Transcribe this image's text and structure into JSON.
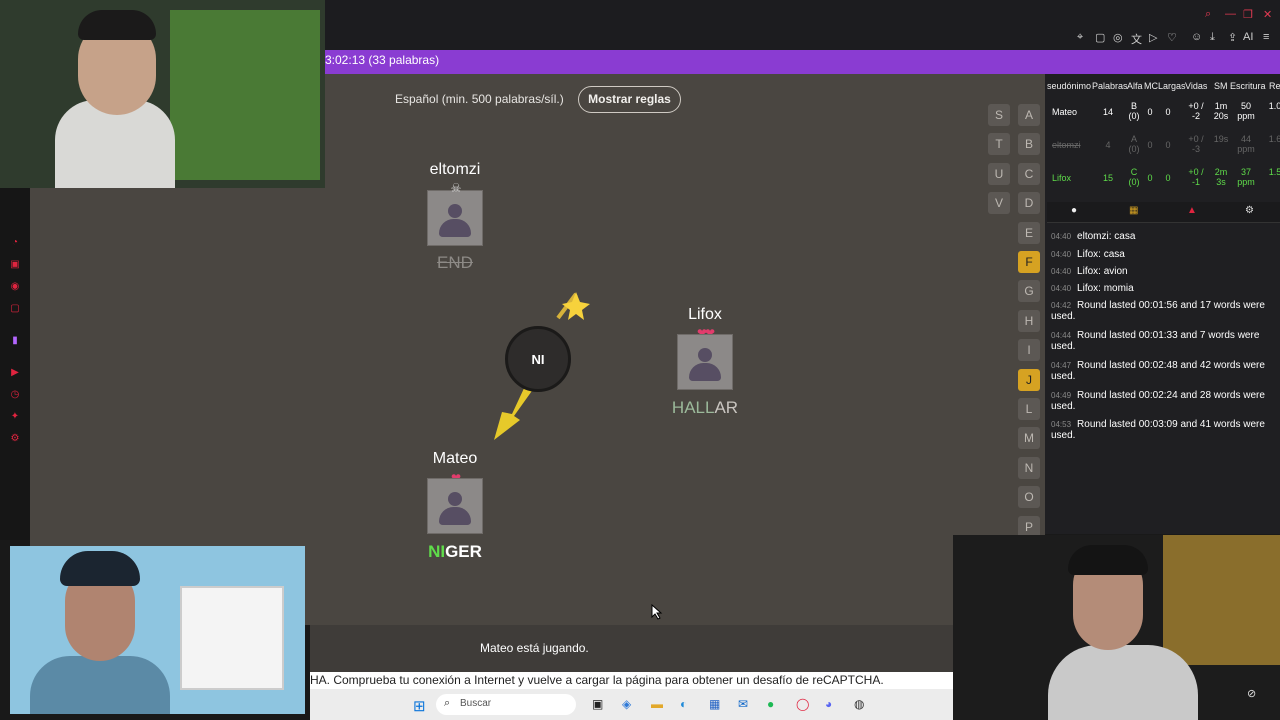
{
  "game": {
    "timer": "3:02:13 (33 palabras)",
    "language": "Español (min. 500 palabras/síl.)",
    "rules_button": "Mostrar reglas",
    "syllable": "NI",
    "status": "Mateo está jugando."
  },
  "players": [
    {
      "name": "eltomzi",
      "word": "END",
      "lives": "☠"
    },
    {
      "name": "Lifox",
      "word_hl": "HALL",
      "word_rest": "AR",
      "lives": "❤❤"
    },
    {
      "name": "Mateo",
      "word_hl": "NI",
      "word_rest": "GER",
      "lives": "❤"
    }
  ],
  "letters_col1": [
    "S",
    "T",
    "U",
    "V"
  ],
  "letters_col2": [
    "A",
    "B",
    "C",
    "D",
    "E",
    "F",
    "G",
    "H",
    "I",
    "J",
    "L",
    "M",
    "N",
    "O",
    "P"
  ],
  "highlighted_letters": [
    "F",
    "J"
  ],
  "table": {
    "headers": [
      "seudónimo",
      "Palabras",
      "Alfa",
      "MC",
      "Largas",
      "Vidas",
      "Escritura",
      "Re"
    ],
    "rows": [
      {
        "name": "Mateo",
        "words": "14",
        "alfa": "B (0)",
        "mc": "0",
        "largas": "0",
        "vidas": "+0 / -2",
        "sm": "1m 20s",
        "esc": "50 ppm",
        "re": "1.0"
      },
      {
        "name": "eltomzi",
        "words": "4",
        "alfa": "A (0)",
        "mc": "0",
        "largas": "0",
        "vidas": "+0 / -3",
        "sm": "19s",
        "esc": "44 ppm",
        "re": "1.6"
      },
      {
        "name": "Lifox",
        "words": "15",
        "alfa": "C (0)",
        "mc": "0",
        "largas": "0",
        "vidas": "+0 / -1",
        "sm": "2m 3s",
        "esc": "37 ppm",
        "re": "1.5"
      }
    ],
    "sm_header": "SM"
  },
  "chat": [
    {
      "time": "04:40",
      "text": "eltomzi: casa"
    },
    {
      "time": "04:40",
      "text": "Lifox: casa"
    },
    {
      "time": "04:40",
      "text": "Lifox: avion"
    },
    {
      "time": "04:40",
      "text": "Lifox: momia"
    },
    {
      "time": "04:42",
      "text": "Round lasted 00:01:56 and 17 words were used."
    },
    {
      "time": "04:44",
      "text": "Round lasted 00:01:33 and 7 words were used."
    },
    {
      "time": "04:47",
      "text": "Round lasted 00:02:48 and 42 words were used."
    },
    {
      "time": "04:49",
      "text": "Round lasted 00:02:24 and 28 words were used."
    },
    {
      "time": "04:53",
      "text": "Round lasted 00:03:09 and 41 words were used."
    }
  ],
  "captcha": "HA. Comprueba tu conexión a Internet y vuelve a cargar la página para obtener un desafío de reCAPTCHA.",
  "taskbar": {
    "search": "Buscar"
  },
  "colors": {
    "accent": "#8a3cd2",
    "green": "#5fdc4a",
    "letter_on": "#d6a222"
  }
}
